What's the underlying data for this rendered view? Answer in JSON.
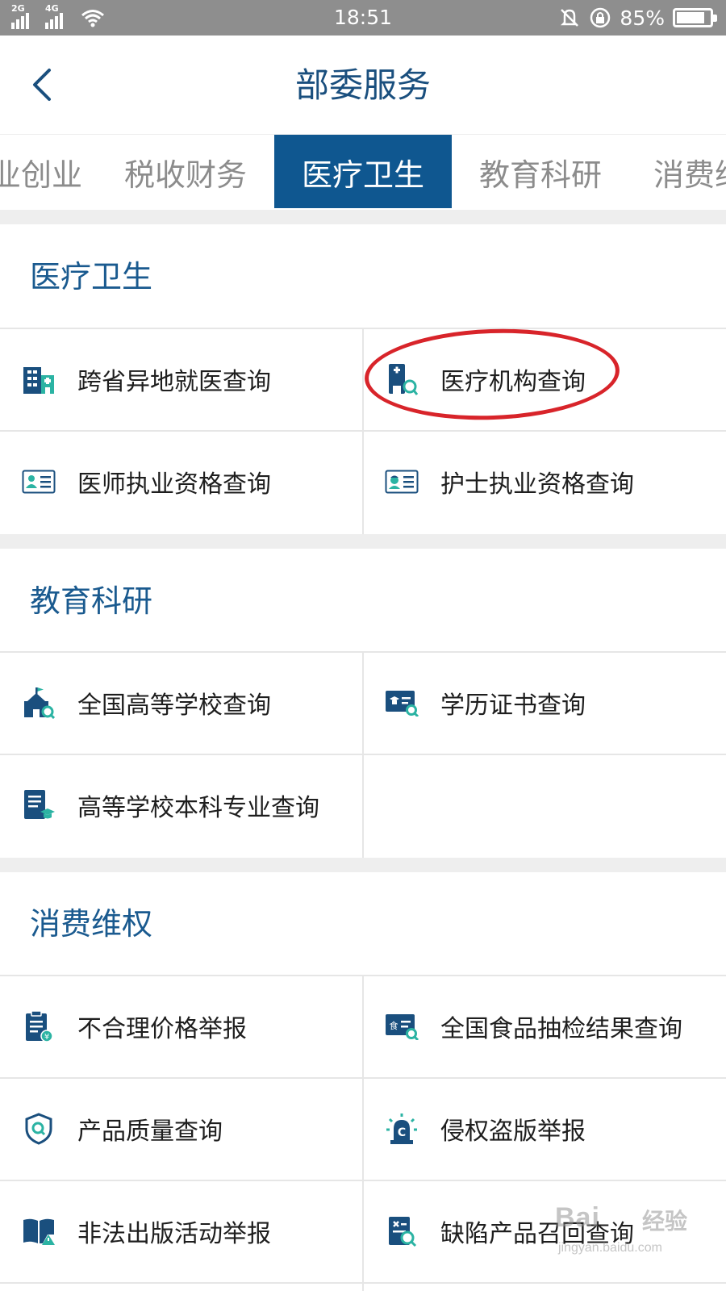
{
  "status_bar": {
    "network_1": "2G",
    "network_2": "4G",
    "time": "18:51",
    "battery_text": "85%",
    "battery_level": 0.85,
    "icons": [
      "signal-icon",
      "wifi-icon",
      "mute-icon",
      "rotation-lock-icon",
      "battery-icon"
    ]
  },
  "header": {
    "title": "部委服务",
    "back_icon": "chevron-left-icon"
  },
  "tabs": [
    {
      "label": "业创业",
      "active": false
    },
    {
      "label": "税收财务",
      "active": false
    },
    {
      "label": "医疗卫生",
      "active": true
    },
    {
      "label": "教育科研",
      "active": false
    },
    {
      "label": "消费维",
      "active": false
    }
  ],
  "sections": [
    {
      "title": "医疗卫生",
      "items": [
        {
          "label": "跨省异地就医查询",
          "icon": "hospital-building-icon"
        },
        {
          "label": "医疗机构查询",
          "icon": "medical-institution-search-icon",
          "highlighted": true
        },
        {
          "label": "医师执业资格查询",
          "icon": "doctor-id-card-icon"
        },
        {
          "label": "护士执业资格查询",
          "icon": "nurse-id-card-icon"
        }
      ]
    },
    {
      "title": "教育科研",
      "items": [
        {
          "label": "全国高等学校查询",
          "icon": "school-search-icon"
        },
        {
          "label": "学历证书查询",
          "icon": "diploma-card-search-icon"
        },
        {
          "label": "高等学校本科专业查询",
          "icon": "major-document-icon"
        }
      ]
    },
    {
      "title": "消费维权",
      "items": [
        {
          "label": "不合理价格举报",
          "icon": "price-report-clipboard-icon"
        },
        {
          "label": "全国食品抽检结果查询",
          "icon": "food-inspection-card-icon"
        },
        {
          "label": "产品质量查询",
          "icon": "quality-shield-icon"
        },
        {
          "label": "侵权盗版举报",
          "icon": "alarm-siren-icon"
        },
        {
          "label": "非法出版活动举报",
          "icon": "illegal-book-icon"
        },
        {
          "label": "缺陷产品召回查询",
          "icon": "defect-recall-search-icon"
        }
      ]
    }
  ],
  "watermark": {
    "brand": "Bai",
    "brand_cn": "经验",
    "url": "jingyan.baidu.com"
  },
  "colors": {
    "status_bar": "#8e8e8e",
    "primary": "#0f5790",
    "title_text": "#1a4f7e",
    "section_title": "#1a5a8f",
    "icon_teal": "#2bb3a3",
    "highlight_circle": "#d8242a"
  }
}
